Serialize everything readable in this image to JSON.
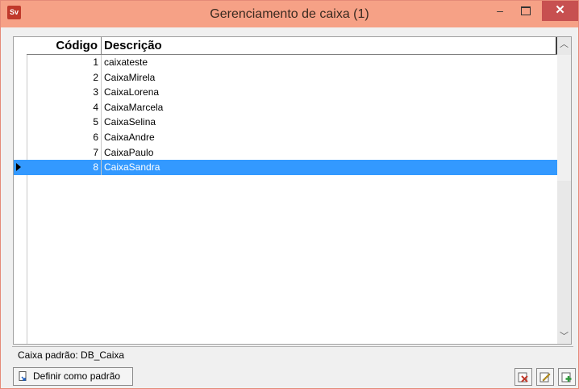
{
  "window": {
    "title": "Gerenciamento de caixa (1)",
    "app_icon_text": "Sv"
  },
  "grid": {
    "columns": {
      "codigo": "Código",
      "descricao": "Descrição"
    },
    "rows": [
      {
        "codigo": "1",
        "descricao": "caixateste"
      },
      {
        "codigo": "2",
        "descricao": "CaixaMirela"
      },
      {
        "codigo": "3",
        "descricao": "CaixaLorena"
      },
      {
        "codigo": "4",
        "descricao": "CaixaMarcela"
      },
      {
        "codigo": "5",
        "descricao": "CaixaSelina"
      },
      {
        "codigo": "6",
        "descricao": "CaixaAndre"
      },
      {
        "codigo": "7",
        "descricao": "CaixaPaulo"
      },
      {
        "codigo": "8",
        "descricao": "CaixaSandra"
      }
    ],
    "selected_row": 8
  },
  "status": {
    "default_caixa": "Caixa padrão: DB_Caixa"
  },
  "buttons": {
    "definir_label": "Definir como padrão",
    "delete_icon": "delete-icon",
    "edit_icon": "edit-icon",
    "add_icon": "add-icon"
  },
  "colors": {
    "titlebar": "#f6a186",
    "selection": "#3399ff",
    "close_button": "#c75050"
  }
}
